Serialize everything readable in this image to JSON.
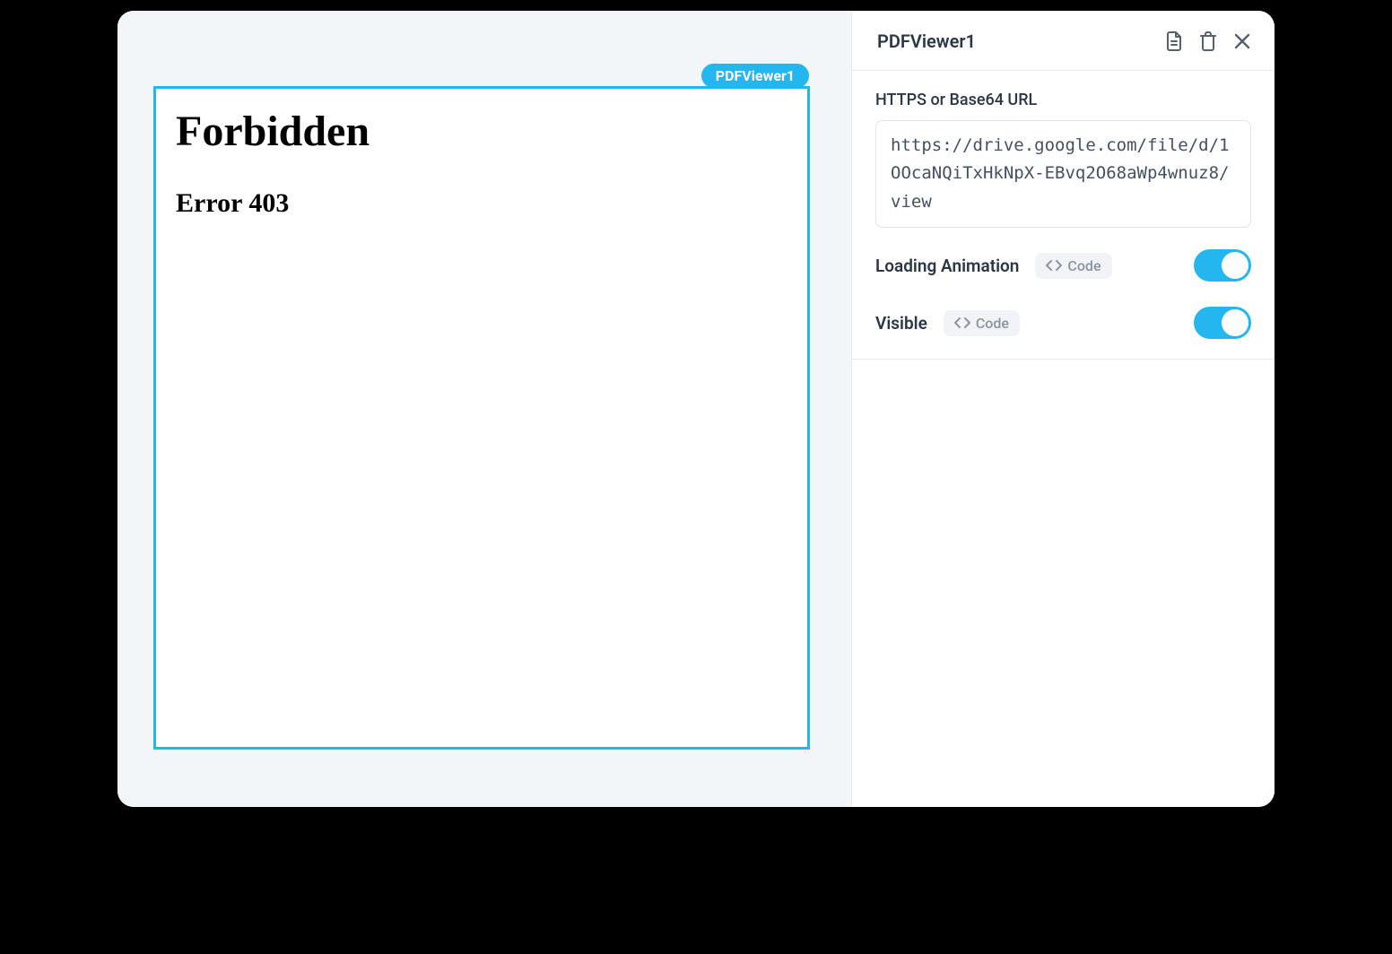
{
  "canvas": {
    "widget_tag": "PDFViewer1",
    "error_title": "Forbidden",
    "error_subtitle": "Error 403"
  },
  "panel": {
    "title": "PDFViewer1",
    "url_field_label": "HTTPS or Base64 URL",
    "url_value": "https://drive.google.com/file/d/1OOcaNQiTxHkNpX-EBvq2O68aWp4wnuz8/view",
    "props": {
      "loading_animation": {
        "label": "Loading Animation",
        "code_chip": "Code",
        "on": true
      },
      "visible": {
        "label": "Visible",
        "code_chip": "Code",
        "on": true
      }
    }
  }
}
